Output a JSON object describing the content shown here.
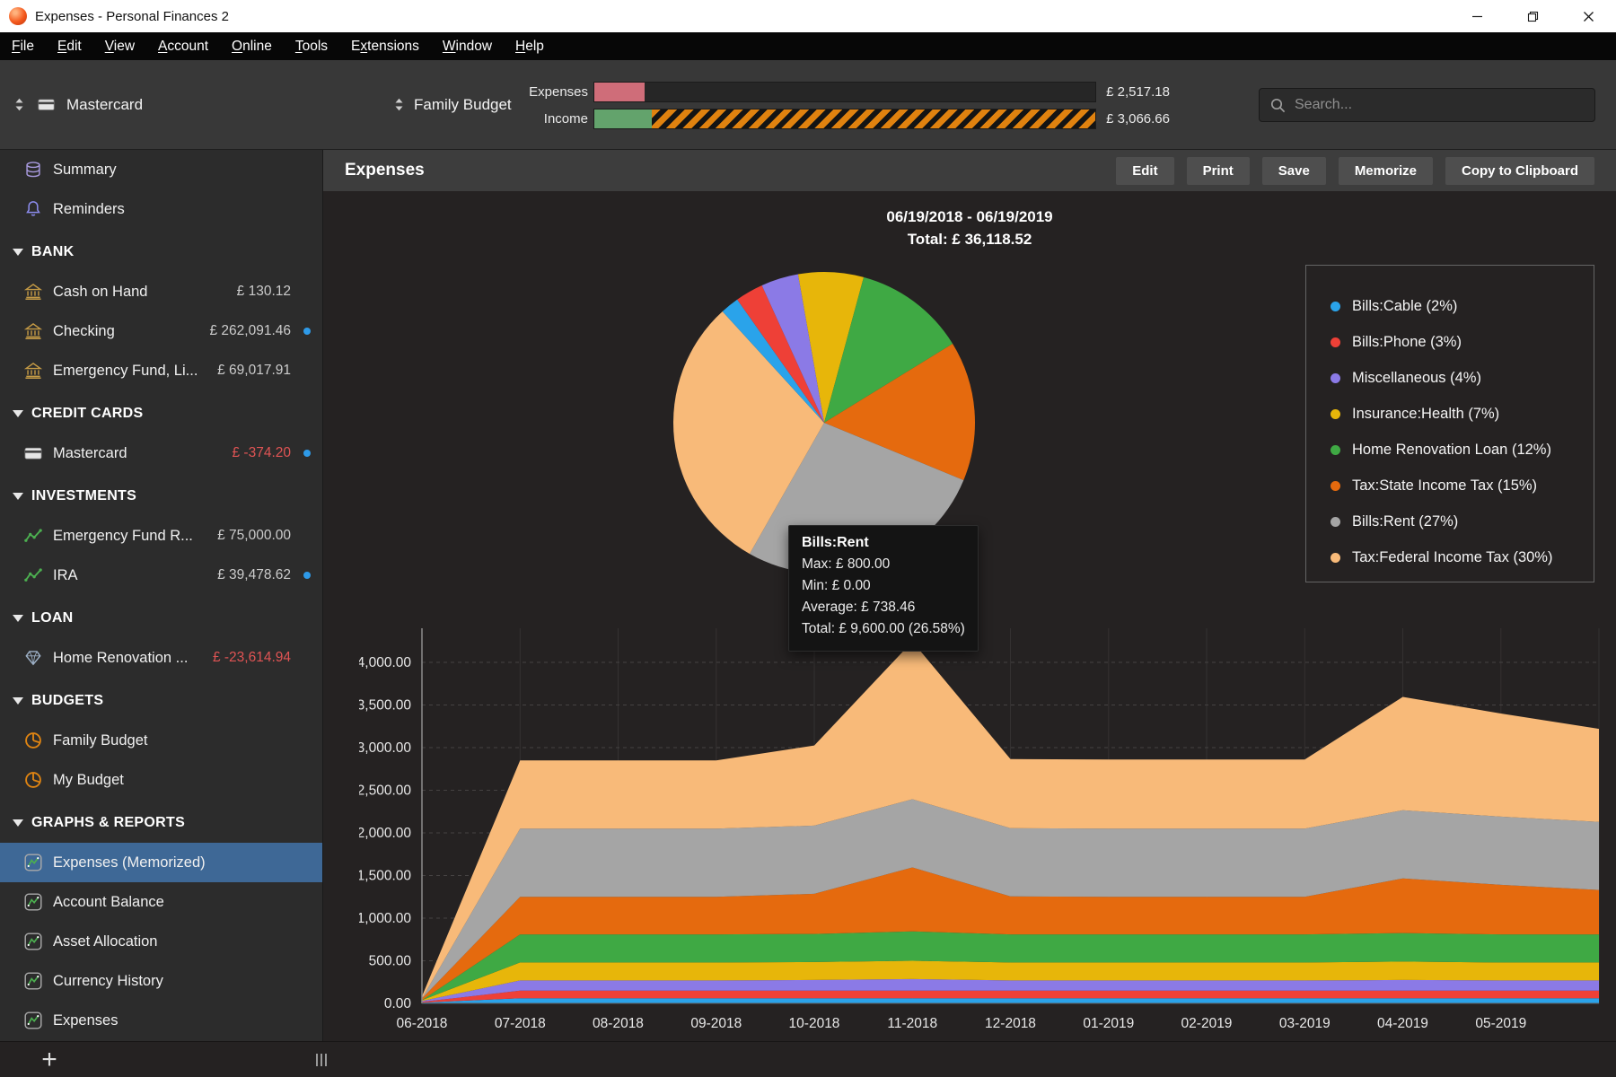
{
  "window": {
    "title": "Expenses - Personal Finances 2"
  },
  "menu": {
    "items": [
      {
        "label": "File",
        "mnemonic": 0
      },
      {
        "label": "Edit",
        "mnemonic": 0
      },
      {
        "label": "View",
        "mnemonic": 0
      },
      {
        "label": "Account",
        "mnemonic": 0
      },
      {
        "label": "Online",
        "mnemonic": 0
      },
      {
        "label": "Tools",
        "mnemonic": 0
      },
      {
        "label": "Extensions",
        "mnemonic": 1
      },
      {
        "label": "Window",
        "mnemonic": 0
      },
      {
        "label": "Help",
        "mnemonic": 0
      }
    ]
  },
  "toolbar": {
    "account_selector": {
      "label": "Mastercard"
    },
    "budget_selector": {
      "label": "Family Budget"
    },
    "budget_bars": {
      "expenses": {
        "label": "Expenses",
        "amount": "£ 2,517.18",
        "fill_pct": 10
      },
      "income": {
        "label": "Income",
        "amount": "£ 3,066.66",
        "fill_pct": 11.5
      }
    },
    "colors": {
      "expenses_fill": "#cf6d79",
      "income_fill": "#63a36c",
      "income_remainder": "#e0820f"
    },
    "search": {
      "placeholder": "Search..."
    }
  },
  "sidebar": {
    "top_items": [
      {
        "label": "Summary",
        "icon": "coins"
      },
      {
        "label": "Reminders",
        "icon": "bell"
      }
    ],
    "sections": [
      {
        "header": "BANK",
        "items": [
          {
            "label": "Cash on Hand",
            "icon": "bank",
            "amount": "£ 130.12"
          },
          {
            "label": "Checking",
            "icon": "bank",
            "amount": "£ 262,091.46",
            "dot": true
          },
          {
            "label": "Emergency Fund, Li...",
            "icon": "bank",
            "amount": "£ 69,017.91"
          }
        ]
      },
      {
        "header": "CREDIT CARDS",
        "items": [
          {
            "label": "Mastercard",
            "icon": "card",
            "amount": "£ -374.20",
            "negative": true,
            "dot": true
          }
        ]
      },
      {
        "header": "INVESTMENTS",
        "items": [
          {
            "label": "Emergency Fund R...",
            "icon": "chart-line",
            "amount": "£ 75,000.00"
          },
          {
            "label": "IRA",
            "icon": "chart-line",
            "amount": "£ 39,478.62",
            "dot": true
          }
        ]
      },
      {
        "header": "LOAN",
        "items": [
          {
            "label": "Home Renovation ...",
            "icon": "diamond",
            "amount": "£ -23,614.94",
            "negative": true
          }
        ]
      },
      {
        "header": "BUDGETS",
        "items": [
          {
            "label": "Family Budget",
            "icon": "pie"
          },
          {
            "label": "My Budget",
            "icon": "pie"
          }
        ]
      },
      {
        "header": "GRAPHS & REPORTS",
        "items": [
          {
            "label": "Expenses (Memorized)",
            "icon": "report",
            "selected": true
          },
          {
            "label": "Account Balance",
            "icon": "report"
          },
          {
            "label": "Asset Allocation",
            "icon": "report"
          },
          {
            "label": "Currency History",
            "icon": "report"
          },
          {
            "label": "Expenses",
            "icon": "report"
          }
        ]
      }
    ]
  },
  "report": {
    "title": "Expenses",
    "buttons": [
      "Edit",
      "Print",
      "Save",
      "Memorize",
      "Copy to Clipboard"
    ],
    "date_range": "06/19/2018 - 06/19/2019",
    "total_line": "Total: £ 36,118.52",
    "tooltip": {
      "title": "Bills:Rent",
      "lines": [
        "Max: £ 800.00",
        "Min: £ 0.00",
        "Average: £ 738.46",
        "Total: £ 9,600.00 (26.58%)"
      ]
    }
  },
  "chart_data": [
    {
      "type": "pie",
      "title": "06/19/2018 - 06/19/2019",
      "subtitle": "Total: £ 36,118.52",
      "slices": [
        {
          "name": "Bills:Cable",
          "label": "Bills:Cable (2%)",
          "pct": 2,
          "color": "#2aa3ea"
        },
        {
          "name": "Bills:Phone",
          "label": "Bills:Phone (3%)",
          "pct": 3,
          "color": "#ee4037"
        },
        {
          "name": "Miscellaneous",
          "label": "Miscellaneous (4%)",
          "pct": 4,
          "color": "#8b7ae6"
        },
        {
          "name": "Insurance:Health",
          "label": "Insurance:Health (7%)",
          "pct": 7,
          "color": "#e7b60a"
        },
        {
          "name": "Home Renovation Loan",
          "label": "Home Renovation Loan (12%)",
          "pct": 12,
          "color": "#3fa944"
        },
        {
          "name": "Tax:State Income Tax",
          "label": "Tax:State Income Tax (15%)",
          "pct": 15,
          "color": "#e56a0e"
        },
        {
          "name": "Bills:Rent",
          "label": "Bills:Rent (27%)",
          "pct": 27,
          "color": "#a5a5a5"
        },
        {
          "name": "Tax:Federal Income Tax",
          "label": "Tax:Federal Income Tax (30%)",
          "pct": 30,
          "color": "#f8ba79"
        }
      ],
      "draw_order": [
        3,
        4,
        5,
        6,
        7,
        0,
        1,
        2
      ],
      "start_angle_deg": -10,
      "legend_position": "right"
    },
    {
      "type": "area",
      "stacked": true,
      "x": [
        "06-2018",
        "07-2018",
        "08-2018",
        "09-2018",
        "10-2018",
        "11-2018",
        "12-2018",
        "01-2019",
        "02-2019",
        "03-2019",
        "04-2019",
        "05-2019",
        ""
      ],
      "series": [
        {
          "name": "Bills:Cable",
          "color": "#2aa3ea",
          "values": [
            10,
            60,
            60,
            60,
            60,
            60,
            60,
            60,
            60,
            60,
            60,
            60,
            60
          ]
        },
        {
          "name": "Bills:Phone",
          "color": "#ee4037",
          "values": [
            8,
            90,
            90,
            90,
            90,
            90,
            90,
            90,
            90,
            90,
            90,
            90,
            90
          ]
        },
        {
          "name": "Miscellaneous",
          "color": "#8b7ae6",
          "values": [
            10,
            120,
            120,
            120,
            125,
            135,
            120,
            120,
            120,
            120,
            125,
            120,
            120
          ]
        },
        {
          "name": "Insurance:Health",
          "color": "#e7b60a",
          "values": [
            10,
            210,
            210,
            210,
            210,
            215,
            210,
            210,
            210,
            210,
            215,
            210,
            210
          ]
        },
        {
          "name": "Home Renovation Loan",
          "color": "#3fa944",
          "values": [
            0,
            330,
            330,
            330,
            330,
            345,
            330,
            330,
            330,
            330,
            335,
            330,
            330
          ]
        },
        {
          "name": "Tax:State Income Tax",
          "color": "#e56a0e",
          "values": [
            20,
            440,
            440,
            440,
            470,
            750,
            445,
            440,
            440,
            440,
            640,
            580,
            520
          ]
        },
        {
          "name": "Bills:Rent",
          "color": "#a5a5a5",
          "values": [
            0,
            800,
            800,
            800,
            800,
            800,
            800,
            800,
            800,
            800,
            800,
            800,
            800
          ]
        },
        {
          "name": "Tax:Federal Income Tax",
          "color": "#f8ba79",
          "values": [
            25,
            800,
            800,
            800,
            940,
            1850,
            810,
            810,
            810,
            810,
            1330,
            1210,
            1090
          ]
        }
      ],
      "ylim": [
        0,
        4400
      ],
      "ytick_step": 500,
      "yticks": [
        "0.00",
        "500.00",
        "1,000.00",
        "1,500.00",
        "2,000.00",
        "2,500.00",
        "3,000.00",
        "3,500.00",
        "4,000.00"
      ],
      "xlabel": "",
      "ylabel": "",
      "grid": true,
      "legend_position": "none"
    }
  ],
  "bottom_bar": {
    "plus": "+"
  }
}
